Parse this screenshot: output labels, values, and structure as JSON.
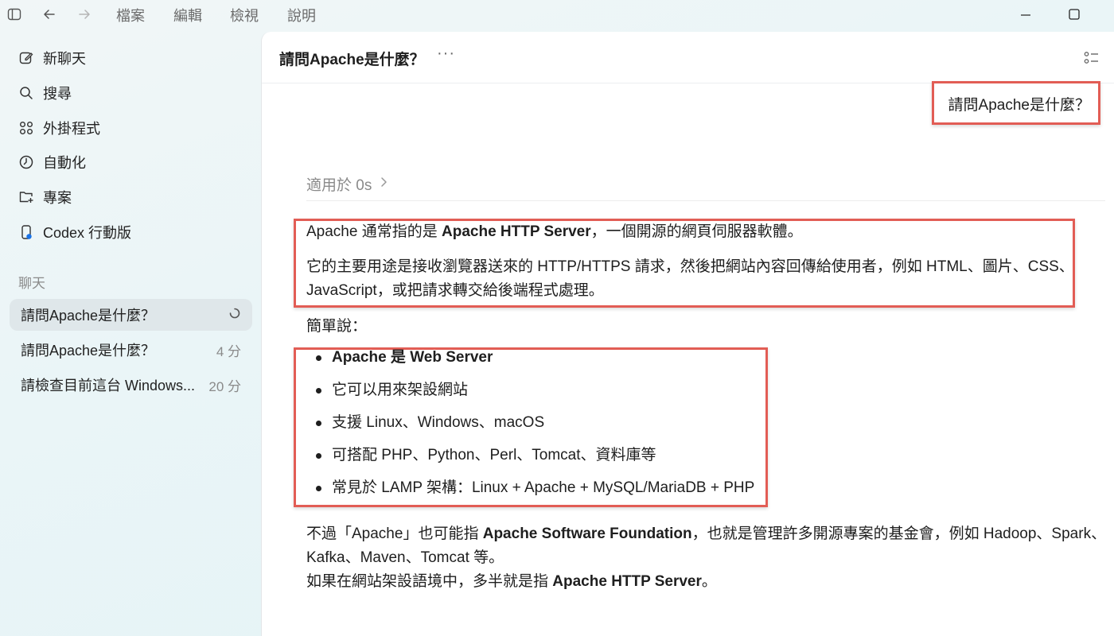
{
  "menu": {
    "file": "檔案",
    "edit": "編輯",
    "view": "檢視",
    "help": "說明"
  },
  "sidebar": {
    "nav": [
      {
        "label": "新聊天",
        "icon": "edit-icon"
      },
      {
        "label": "搜尋",
        "icon": "search-icon"
      },
      {
        "label": "外掛程式",
        "icon": "plugins-icon"
      },
      {
        "label": "自動化",
        "icon": "clock-icon"
      },
      {
        "label": "專案",
        "icon": "folder-add-icon"
      },
      {
        "label": "Codex 行動版",
        "icon": "mobile-icon"
      }
    ],
    "section_label": "聊天",
    "chats": [
      {
        "title": "請問Apache是什麼？",
        "meta": ""
      },
      {
        "title": "請問Apache是什麼？",
        "meta": "4 分"
      },
      {
        "title": "請檢查目前這台 Windows...",
        "meta": "20 分"
      }
    ]
  },
  "main": {
    "title": "請問Apache是什麼？",
    "more": "···",
    "user_message": "請問Apache是什麼？",
    "worked_label": "適用於 0s",
    "response": {
      "p1_pre": "Apache 通常指的是 ",
      "p1_bold": "Apache HTTP Server",
      "p1_post": "，一個開源的網頁伺服器軟體。",
      "p2_line1": "它的主要用途是接收瀏覽器送來的 HTTP/HTTPS 請求，然後把網站內容回傳給使用者，例如 HTML、圖片、CSS、",
      "p2_line2": "JavaScript，或把請求轉交給後端程式處理。",
      "summary_label": "簡單說：",
      "bullets": [
        "Apache 是 Web Server",
        "它可以用來架設網站",
        "支援 Linux、Windows、macOS",
        "可搭配 PHP、Python、Perl、Tomcat、資料庫等",
        "常見於 LAMP 架構：Linux + Apache + MySQL/MariaDB + PHP"
      ],
      "p3_pre": "不過「Apache」也可能指 ",
      "p3_bold": "Apache Software Foundation",
      "p3_post": "，也就是管理許多開源專案的基金會，例如 Hadoop、Spark、",
      "p3_line2": "Kafka、Maven、Tomcat 等。",
      "p4_pre": "如果在網站架設語境中，多半就是指 ",
      "p4_bold": "Apache HTTP Server",
      "p4_post": "。"
    }
  },
  "colors": {
    "highlight": "#e25d55",
    "active_chat_bg": "#dfe7ea"
  }
}
